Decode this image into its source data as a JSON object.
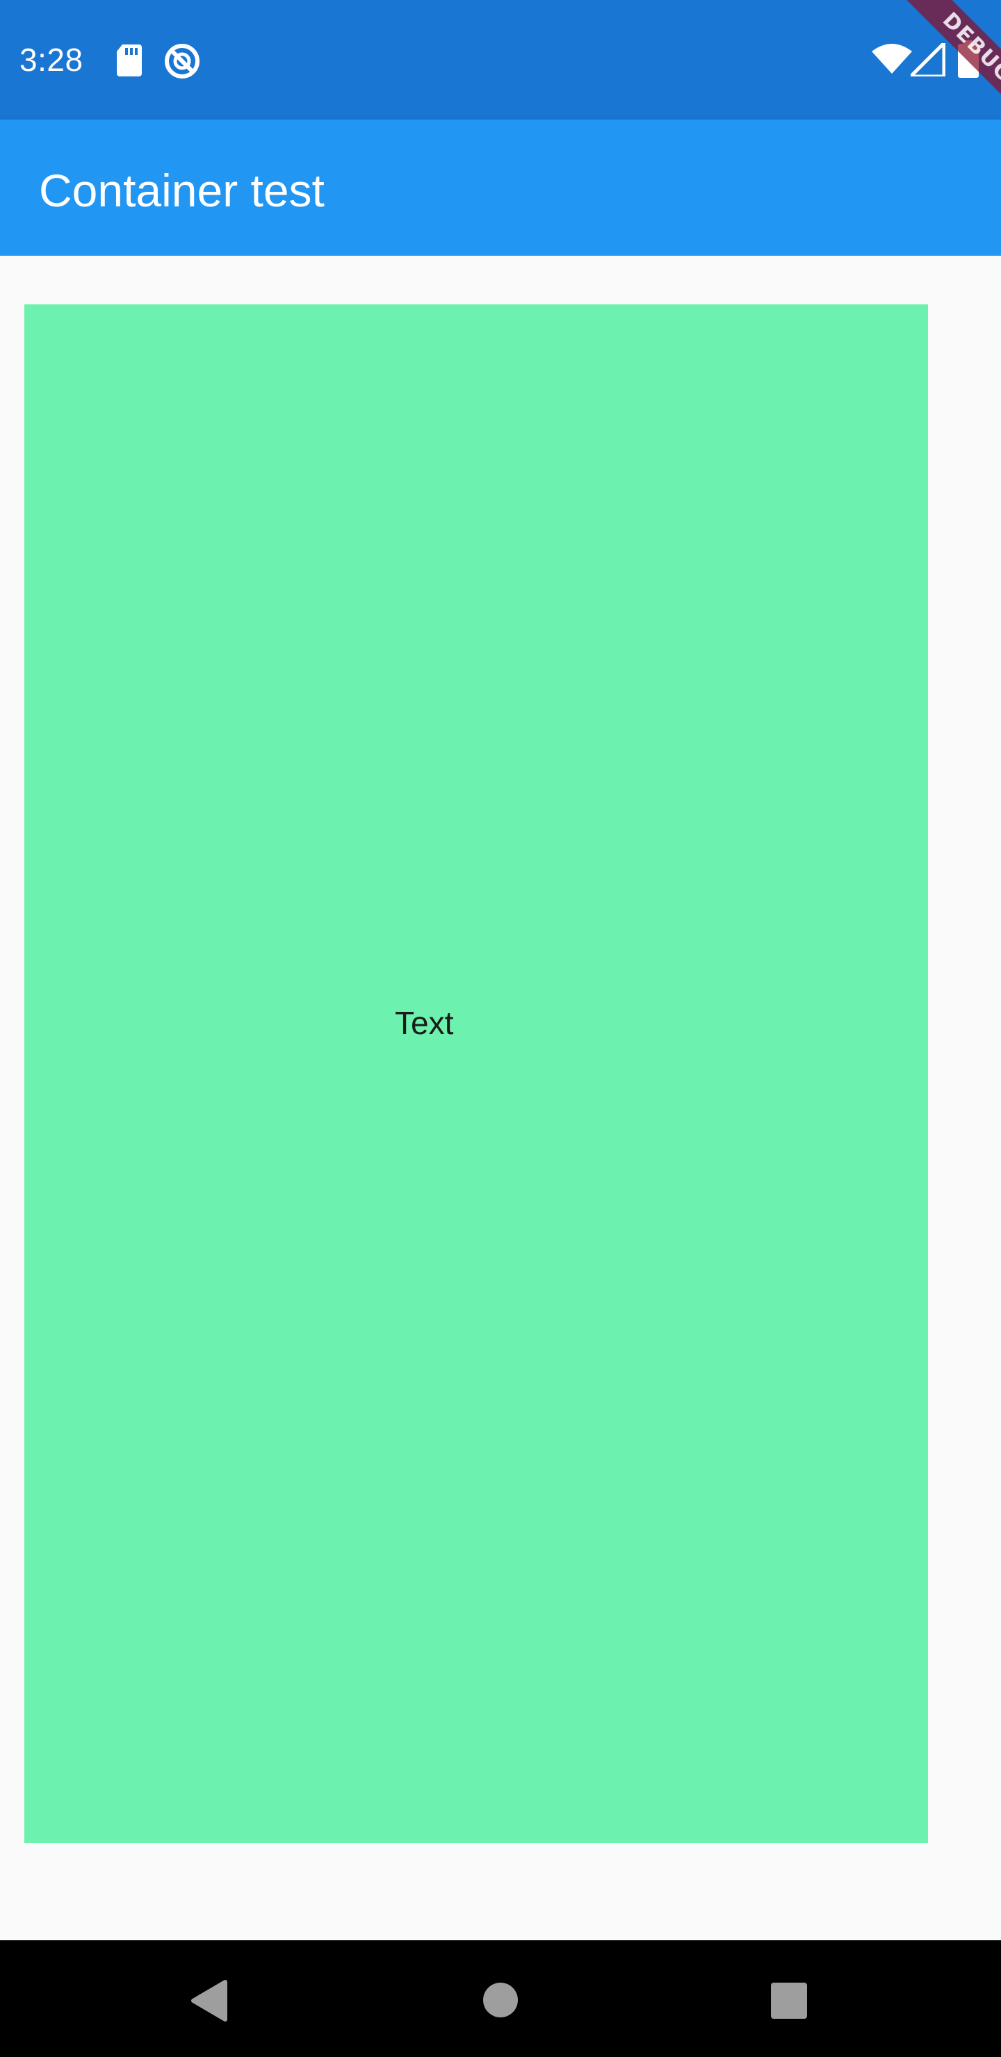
{
  "status_bar": {
    "time": "3:28",
    "icons": [
      "sd-card-icon",
      "do-not-disturb-icon",
      "wifi-icon",
      "signal-icon",
      "battery-icon"
    ]
  },
  "debug_banner": {
    "label": "DEBUG"
  },
  "app_bar": {
    "title": "Container test"
  },
  "main": {
    "container": {
      "text": "Text",
      "color": "#6cf2ae"
    }
  },
  "nav_bar": {
    "buttons": [
      "back-button",
      "home-button",
      "recents-button"
    ]
  },
  "colors": {
    "status_bar": "#1976d2",
    "app_bar": "#2196f3",
    "background": "#fafafa",
    "nav_bar": "#000000"
  }
}
